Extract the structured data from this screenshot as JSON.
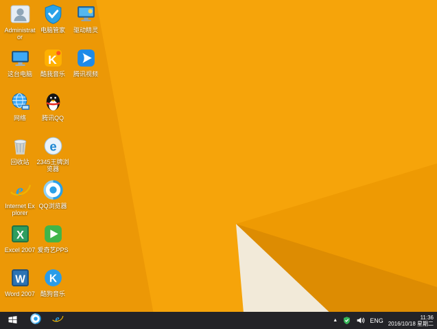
{
  "wallpaper": {
    "base_color": "#F6A40A",
    "left_band_color": "#EC9806",
    "fold_mid_color": "#EE9A03",
    "fold_dark_color": "#DD8C02",
    "fold_cream_color": "#F2EAD9"
  },
  "desktop": {
    "icons": [
      {
        "id": "administrator",
        "label": "Administrator",
        "icon": "user-folder-icon"
      },
      {
        "id": "this-pc",
        "label": "这台电脑",
        "icon": "computer-icon"
      },
      {
        "id": "network",
        "label": "网络",
        "icon": "network-globe-icon"
      },
      {
        "id": "recycle-bin",
        "label": "回收站",
        "icon": "recycle-bin-icon"
      },
      {
        "id": "internet-explorer",
        "label": "Internet Explorer",
        "icon": "ie-icon"
      },
      {
        "id": "excel-2007",
        "label": "Excel 2007",
        "icon": "excel-icon"
      },
      {
        "id": "word-2007",
        "label": "Word 2007",
        "icon": "word-icon"
      },
      {
        "id": "pc-manager",
        "label": "电脑管家",
        "icon": "shield-check-icon"
      },
      {
        "id": "kuwo-music",
        "label": "酷我音乐",
        "icon": "music-k-icon"
      },
      {
        "id": "tencent-qq",
        "label": "腾讯QQ",
        "icon": "qq-penguin-icon"
      },
      {
        "id": "2345-browser",
        "label": "2345王牌浏览器",
        "icon": "browser-e-icon"
      },
      {
        "id": "qq-browser",
        "label": "QQ浏览器",
        "icon": "qq-browser-icon"
      },
      {
        "id": "iqiyi-pps",
        "label": "爱奇艺PPS",
        "icon": "iqiyi-play-icon"
      },
      {
        "id": "kugou-music",
        "label": "酷狗音乐",
        "icon": "kugou-k-icon"
      },
      {
        "id": "driver-genius",
        "label": "驱动精灵",
        "icon": "driver-monitor-icon"
      },
      {
        "id": "tencent-video",
        "label": "腾讯视频",
        "icon": "tencent-video-icon"
      }
    ]
  },
  "taskbar": {
    "pinned": [
      {
        "id": "qq-browser",
        "icon": "qq-browser-icon"
      },
      {
        "id": "internet-explorer",
        "icon": "ie-icon"
      }
    ],
    "tray": {
      "hidden_icons_icon": "chevron-up-icon",
      "security_icon": "shield-check-icon",
      "volume_icon": "speaker-icon",
      "language": "ENG",
      "time": "11:36",
      "date": "2016/10/18 星期二"
    }
  }
}
